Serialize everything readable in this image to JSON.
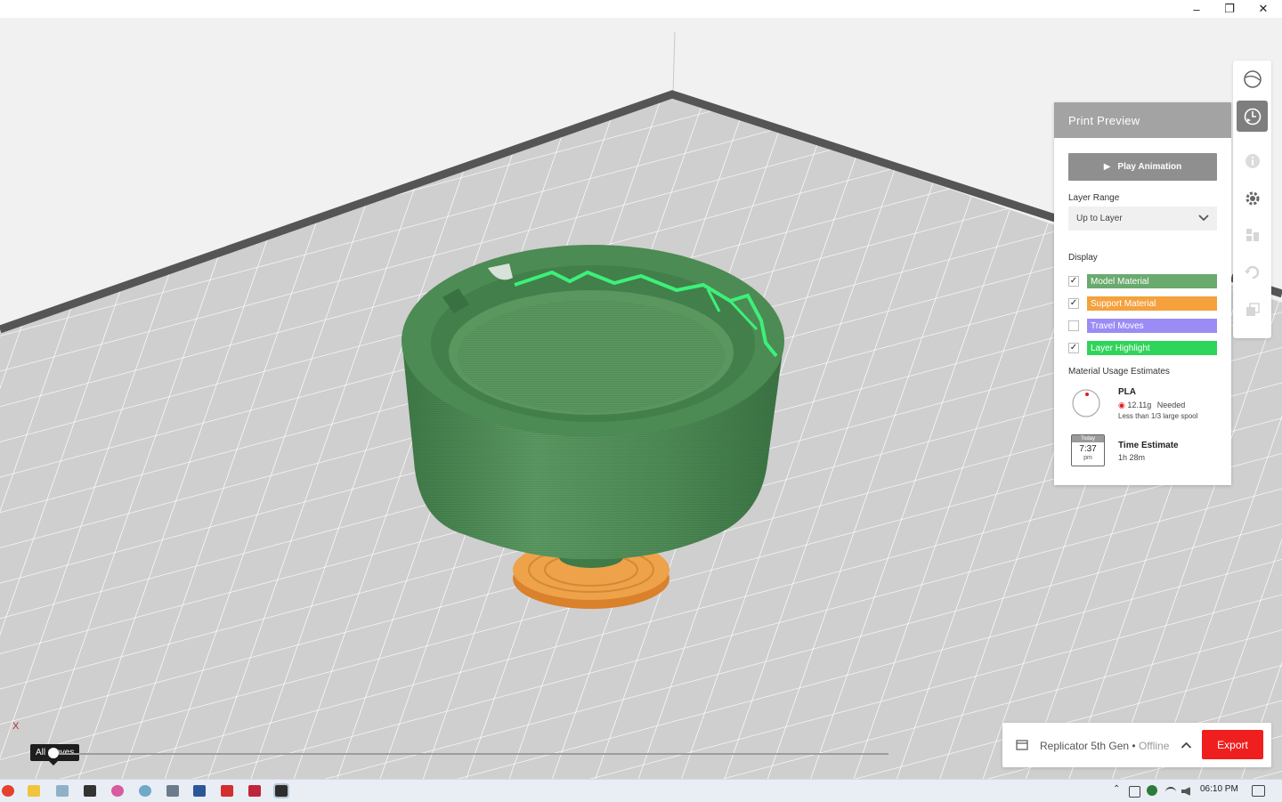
{
  "window": {
    "minimize_icon": "minimize-icon",
    "restore_icon": "restore-icon",
    "close_icon": "close-icon"
  },
  "toolbar": {
    "buttons": [
      "view-globe-icon",
      "print-preview-icon",
      "info-icon",
      "settings-gear-icon",
      "arrange-icon",
      "rotate-icon",
      "scale-icon"
    ],
    "active": "print-preview-icon"
  },
  "print_preview": {
    "title": "Print Preview",
    "play_label": "Play Animation",
    "layer_range_label": "Layer Range",
    "layer_range_value": "Up to Layer",
    "display_label": "Display",
    "display_items": [
      {
        "label": "Model Material",
        "checked": true,
        "color": "#6aaa6e"
      },
      {
        "label": "Support Material",
        "checked": true,
        "color": "#f5a13e"
      },
      {
        "label": "Travel Moves",
        "checked": false,
        "color": "#9b8cf5"
      },
      {
        "label": "Layer Highlight",
        "checked": true,
        "color": "#2fd45a"
      }
    ],
    "material_label": "Material Usage Estimates",
    "material": {
      "name": "PLA",
      "needed": "12.11g",
      "needed_suffix": "Needed",
      "note": "Less than 1/3 large spool"
    },
    "time": {
      "calendar_day": "Today",
      "calendar_time": "7:37",
      "calendar_ampm": "pm",
      "title": "Time Estimate",
      "value": "1h 28m"
    }
  },
  "printer": {
    "name": "Replicator 5th Gen",
    "separator": " • ",
    "status": "Offline",
    "export_label": "Export"
  },
  "scene": {
    "tooltip": "All moves",
    "axis_label": "X",
    "model_color": "#4f8f57",
    "support_color": "#e89535"
  },
  "taskbar": {
    "time": "06:10 PM"
  }
}
